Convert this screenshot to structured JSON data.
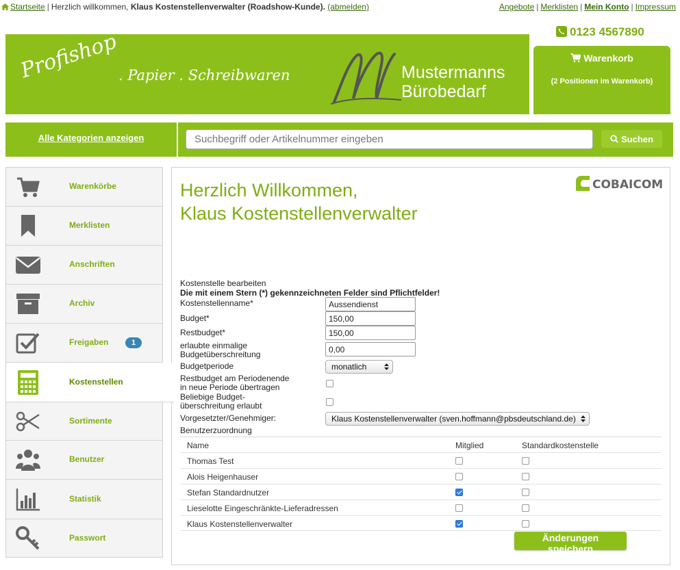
{
  "topbar": {
    "home_link": "Startseite",
    "greeting_prefix": "Herzlich willkommen,",
    "user_name": "Klaus Kostenstellenverwalter (Roadshow-Kunde).",
    "logout_link": "(abmelden)",
    "links": [
      "Angebote",
      "Merklisten",
      "Mein Konto",
      "Impressum"
    ]
  },
  "phone": "0123 4567890",
  "banner": {
    "logo_profishop": "Profishop",
    "logo_tagline": ". Papier . Schreibwaren",
    "logo_brand_line1": "Mustermanns",
    "logo_brand_line2": "Bürobedarf"
  },
  "cart": {
    "title": "Warenkorb",
    "positions": "(2 Positionen im Warenkorb)"
  },
  "nav": {
    "categories_label": "Alle Kategorien anzeigen",
    "search_placeholder": "Suchbegriff oder Artikelnummer eingeben",
    "search_button": "Suchen"
  },
  "sidebar": {
    "items": [
      {
        "label": "Warenkörbe",
        "icon": "cart-icon"
      },
      {
        "label": "Merklisten",
        "icon": "bookmark-icon"
      },
      {
        "label": "Anschriften",
        "icon": "envelope-icon"
      },
      {
        "label": "Archiv",
        "icon": "archive-box-icon"
      },
      {
        "label": "Freigaben",
        "icon": "checkbox-icon",
        "badge": "1"
      },
      {
        "label": "Kostenstellen",
        "icon": "calculator-icon"
      },
      {
        "label": "Sortimente",
        "icon": "scissors-icon"
      },
      {
        "label": "Benutzer",
        "icon": "users-icon"
      },
      {
        "label": "Statistik",
        "icon": "bar-chart-icon"
      },
      {
        "label": "Passwort",
        "icon": "key-icon"
      }
    ]
  },
  "main": {
    "brand_logo": "COBAICOM",
    "welcome_line1": "Herzlich Willkommen,",
    "welcome_line2": "Klaus Kostenstellenverwalter",
    "form": {
      "heading": "Kostenstelle bearbeiten",
      "notice": "Die mit einem Stern (*) gekennzeichneten Felder sind Pflichtfelder!",
      "name_label": "Kostenstellenname*",
      "name_value": "Aussendienst",
      "budget_label": "Budget*",
      "budget_value": "150,00",
      "rest_label": "Restbudget*",
      "rest_value": "150,00",
      "overrun_once_line1": "erlaubte einmalige",
      "overrun_once_line2": "Budgetüberschreitung",
      "overrun_once_value": "0,00",
      "period_label": "Budgetperiode",
      "period_value": "monatlich",
      "carry_line1": "Restbudget am Periodenende",
      "carry_line2": "in neue Periode übertragen",
      "any_overrun_line1": "Beliebige Budget-",
      "any_overrun_line2": "überschreitung erlaubt",
      "approver_label": "Vorgesetzter/Genehmiger:",
      "approver_value": "Klaus Kostenstellenverwalter (sven.hoffmann@pbsdeutschland.de)",
      "assignment_label": "Benutzerzuordnung"
    },
    "table": {
      "headers": [
        "Name",
        "Mitglied",
        "Standardkostenstelle"
      ],
      "rows": [
        {
          "name": "Thomas Test",
          "member": false,
          "default": false
        },
        {
          "name": "Alois Heigenhauser",
          "member": false,
          "default": false
        },
        {
          "name": "Stefan Standardnutzer",
          "member": true,
          "default": false
        },
        {
          "name": "Lieselotte Eingeschränkte-Lieferadressen",
          "member": false,
          "default": false
        },
        {
          "name": "Klaus Kostenstellenverwalter",
          "member": true,
          "default": false
        }
      ]
    },
    "save_button": "Änderungen speichern"
  },
  "colors": {
    "brand_green": "#8dbf1b",
    "text_green": "#7fad12",
    "badge_blue": "#3a86b3",
    "check_blue": "#2f7fe0"
  }
}
